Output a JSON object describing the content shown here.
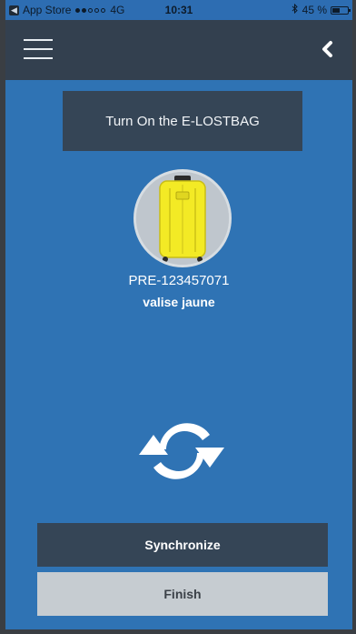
{
  "status_bar": {
    "carrier_app": "App Store",
    "network": "4G",
    "time": "10:31",
    "battery": "45 %",
    "signal_bars_filled": 2,
    "signal_bars_total": 5,
    "battery_level_percent": 45
  },
  "nav": {
    "menu_icon": "hamburger-menu-icon",
    "back_icon": "chevron-left-icon"
  },
  "main": {
    "banner_text": "Turn On the E-LOSTBAG",
    "bag": {
      "image_icon": "yellow-suitcase-image",
      "id": "PRE-123457071",
      "name": "valise jaune"
    },
    "sync_icon": "refresh-icon",
    "synchronize_label": "Synchronize",
    "finish_label": "Finish"
  },
  "colors": {
    "background_blue": "#2f73b4",
    "dark_navy": "#354556",
    "navbar": "#33404f",
    "finish_gray": "#c6ccd1",
    "suitcase_yellow": "#f4ee2c"
  }
}
